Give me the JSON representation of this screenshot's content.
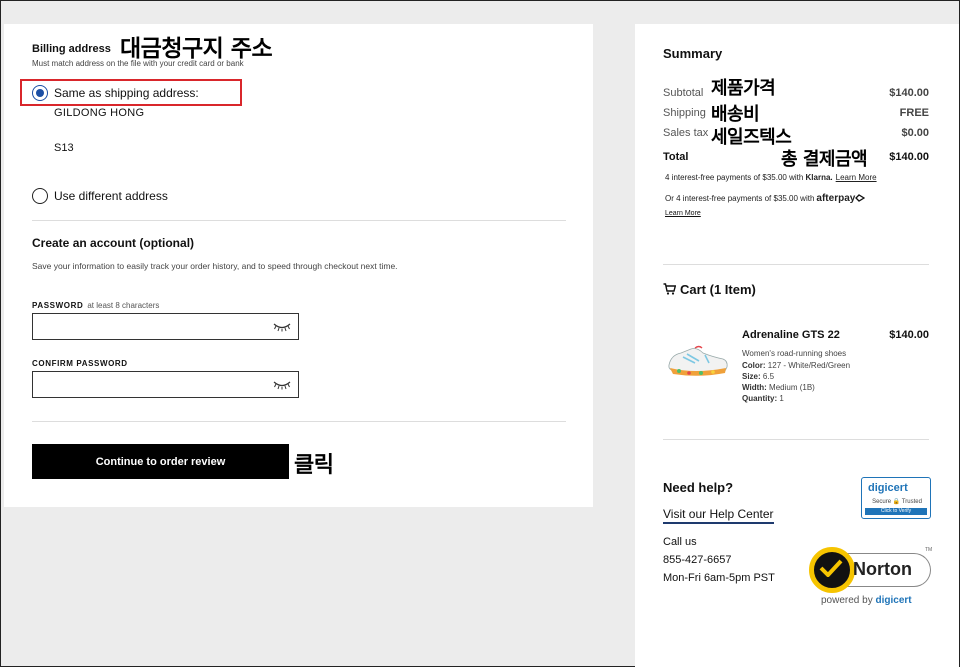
{
  "billing": {
    "title": "Billing address",
    "note": "Must match address on the file with your credit card or bank",
    "annotation": "대금청구지 주소",
    "same_label": "Same as shipping address:",
    "name": "GILDONG HONG",
    "address_line": "S13",
    "different_label": "Use different address"
  },
  "account": {
    "title": "Create an account (optional)",
    "description": "Save your information to easily track your order history, and to speed through checkout next time.",
    "password_label": "PASSWORD",
    "password_hint": "at least 8 characters",
    "confirm_label": "CONFIRM PASSWORD"
  },
  "cta": {
    "label": "Continue to order review",
    "annotation": "클릭"
  },
  "summary": {
    "title": "Summary",
    "subtotal_label": "Subtotal",
    "subtotal_value": "$140.00",
    "subtotal_annotation": "제품가격",
    "shipping_label": "Shipping",
    "shipping_value": "FREE",
    "shipping_annotation": "배송비",
    "tax_label": "Sales tax",
    "tax_value": "$0.00",
    "tax_annotation": "세일즈텍스",
    "total_label": "Total",
    "total_value": "$140.00",
    "total_annotation": "총 결제금액",
    "klarna_text": "4 interest-free payments of $35.00 with",
    "klarna_brand": "Klarna.",
    "klarna_link": "Learn More",
    "afterpay_text": "Or 4 interest-free payments of $35.00 with",
    "afterpay_brand": "afterpay",
    "afterpay_link": "Learn More"
  },
  "cart": {
    "title": "Cart (1 Item)",
    "product_name": "Adrenaline GTS 22",
    "product_price": "$140.00",
    "product_type": "Women's road-running shoes",
    "color_label": "Color:",
    "color_value": "127 - White/Red/Green",
    "size_label": "Size:",
    "size_value": "6.5",
    "width_label": "Width:",
    "width_value": "Medium (1B)",
    "qty_label": "Quantity:",
    "qty_value": "1"
  },
  "help": {
    "title": "Need help?",
    "link": "Visit our Help Center",
    "call_label": "Call us",
    "phone": "855-427-6657",
    "hours": "Mon-Fri 6am-5pm PST"
  },
  "badges": {
    "digicert_name": "digicert",
    "digicert_sub": "Secure 🔒 Trusted",
    "digicert_bar": "Click to Verify",
    "norton_word": "Norton",
    "norton_powered": "powered by",
    "norton_powered_brand": "digicert",
    "norton_tm": "TM"
  },
  "colors": {
    "radio_selected": "#1b4fa5",
    "highlight": "#d9262b",
    "cta_bg": "#000000",
    "digicert_blue": "#1f74b8",
    "norton_yellow": "#f6c400"
  }
}
